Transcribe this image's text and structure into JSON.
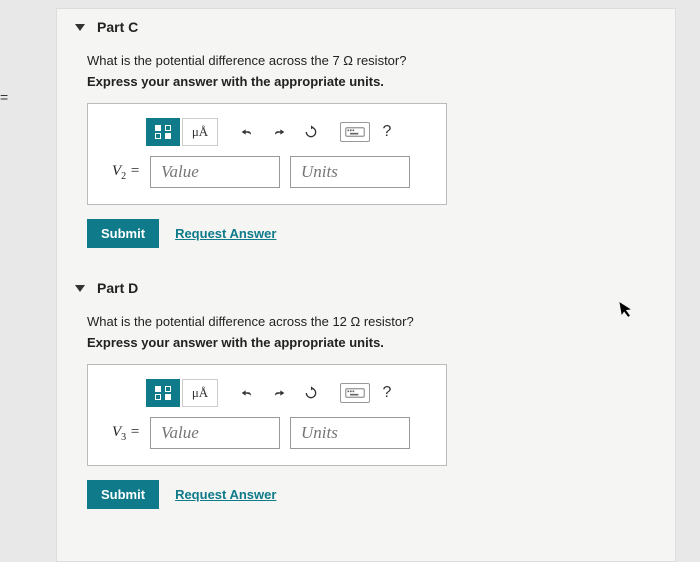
{
  "left_fragment": "=",
  "toolbar": {
    "mua_label": "μÅ",
    "help_label": "?"
  },
  "submit_label": "Submit",
  "request_label": "Request Answer",
  "parts": [
    {
      "title": "Part C",
      "question": "What is the potential difference across the 7 Ω resistor?",
      "instruction": "Express your answer with the appropriate units.",
      "var_html": "V<sub>2</sub> =",
      "value_placeholder": "Value",
      "units_placeholder": "Units"
    },
    {
      "title": "Part D",
      "question": "What is the potential difference across the 12 Ω resistor?",
      "instruction": "Express your answer with the appropriate units.",
      "var_html": "V<sub>3</sub> =",
      "value_placeholder": "Value",
      "units_placeholder": "Units"
    }
  ]
}
